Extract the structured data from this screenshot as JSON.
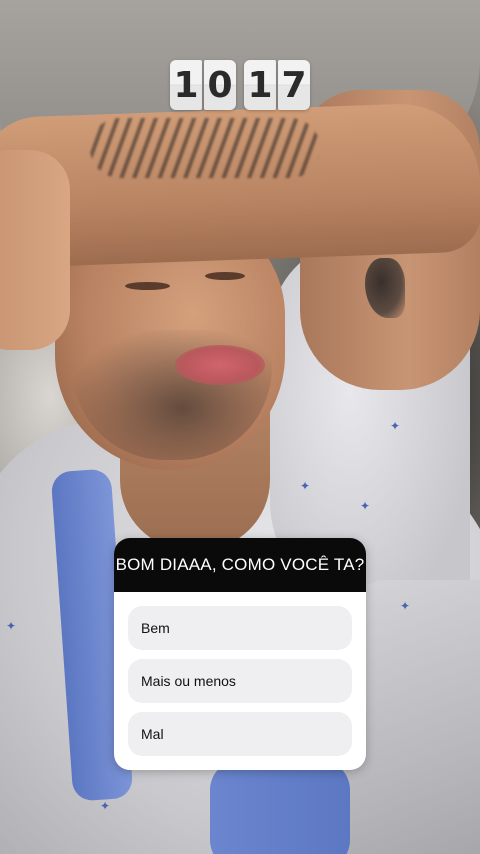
{
  "clock": {
    "hours": [
      "1",
      "0"
    ],
    "minutes": [
      "1",
      "7"
    ]
  },
  "poll": {
    "question": "BOM DIAAA, COMO VOCÊ TA?",
    "options": [
      "Bem",
      "Mais ou menos",
      "Mal"
    ],
    "colors": {
      "header": "#0a0a0a",
      "option_bg": "#efeff1"
    }
  }
}
